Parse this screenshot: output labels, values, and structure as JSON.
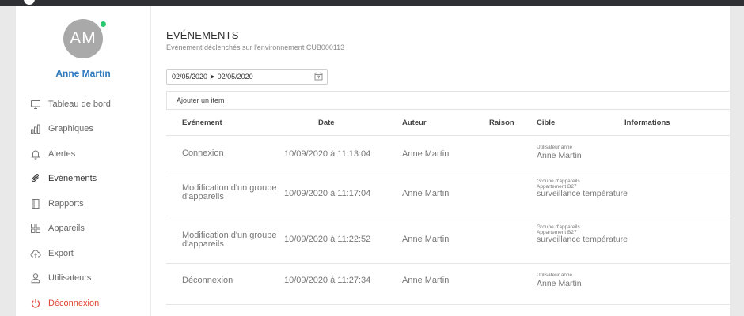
{
  "user": {
    "initials": "AM",
    "name": "Anne Martin",
    "status_color": "#28c76f"
  },
  "sidebar": {
    "items": [
      {
        "label": "Tableau de bord",
        "icon": "monitor-icon"
      },
      {
        "label": "Graphiques",
        "icon": "bar-chart-icon"
      },
      {
        "label": "Alertes",
        "icon": "bell-icon"
      },
      {
        "label": "Evénements",
        "icon": "paperclip-icon",
        "active": true
      },
      {
        "label": "Rapports",
        "icon": "document-icon"
      },
      {
        "label": "Appareils",
        "icon": "grid-icon"
      },
      {
        "label": "Export",
        "icon": "cloud-upload-icon"
      },
      {
        "label": "Utilisateurs",
        "icon": "user-icon"
      },
      {
        "label": "Déconnexion",
        "icon": "power-icon",
        "color": "#e0432f"
      }
    ]
  },
  "page": {
    "title": "EVÉNEMENTS",
    "subtitle": "Evénement déclenchés sur l'environnement CUB000113"
  },
  "filter": {
    "date_range": "02/05/2020 ➤ 02/05/2020",
    "add_item_label": "Ajouter un item"
  },
  "table": {
    "columns": [
      "Evénement",
      "Date",
      "Auteur",
      "Raison",
      "Cible",
      "Informations"
    ],
    "rows": [
      {
        "event": "Connexion",
        "date": "10/09/2020 à 11:13:04",
        "author": "Anne Martin",
        "reason": "",
        "target_type": "Utilisateur anne",
        "target_sub": "",
        "target_name": "Anne Martin",
        "info": ""
      },
      {
        "event": "Modification d'un groupe d'appareils",
        "date": "10/09/2020 à 11:17:04",
        "author": "Anne Martin",
        "reason": "",
        "target_type": "Groupe d'appareils",
        "target_sub": "Appartement B27",
        "target_name": "surveillance température",
        "info": ""
      },
      {
        "event": "Modification d'un groupe d'appareils",
        "date": "10/09/2020 à 11:22:52",
        "author": "Anne Martin",
        "reason": "",
        "target_type": "Groupe d'appareils",
        "target_sub": "Appartement B27",
        "target_name": "surveillance température",
        "info": ""
      },
      {
        "event": "Déconnexion",
        "date": "10/09/2020 à 11:27:34",
        "author": "Anne Martin",
        "reason": "",
        "target_type": "Utilisateur anne",
        "target_sub": "",
        "target_name": "Anne Martin",
        "info": ""
      }
    ]
  }
}
